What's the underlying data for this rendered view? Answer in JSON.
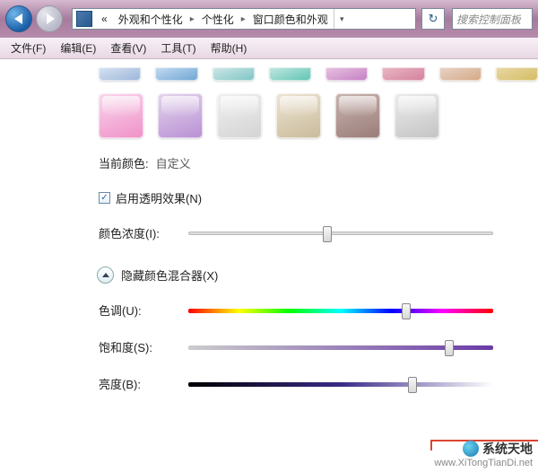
{
  "breadcrumb": {
    "prefix": "«",
    "seg1": "外观和个性化",
    "seg2": "个性化",
    "seg3": "窗口颜色和外观"
  },
  "search": {
    "placeholder": "搜索控制面板"
  },
  "menu": {
    "file": "文件(F)",
    "edit": "编辑(E)",
    "view": "查看(V)",
    "tools": "工具(T)",
    "help": "帮助(H)"
  },
  "current_color_label": "当前颜色:",
  "current_color_value": "自定义",
  "transparency_label": "启用透明效果(N)",
  "transparency_checked": true,
  "intensity_label": "颜色浓度(I):",
  "mixer_label": "隐藏颜色混合器(X)",
  "hue_label": "色调(U):",
  "sat_label": "饱和度(S):",
  "bri_label": "亮度(B):",
  "slider_positions": {
    "intensity": 44,
    "hue": 70,
    "sat": 84,
    "bri": 72
  },
  "watermark": {
    "brand": "系统天地",
    "url": "www.XiTongTianDi.net"
  }
}
